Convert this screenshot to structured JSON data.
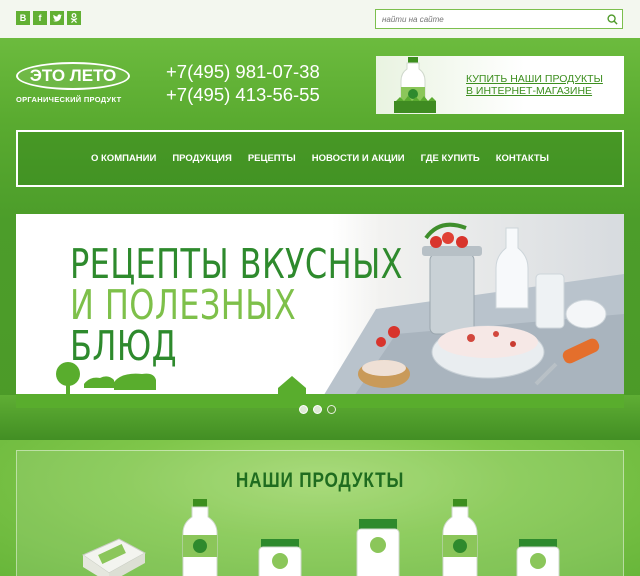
{
  "social": {
    "items": [
      {
        "name": "vk",
        "glyph": "В"
      },
      {
        "name": "facebook",
        "glyph": "f"
      },
      {
        "name": "twitter",
        "glyph": "t"
      },
      {
        "name": "odnoklassniki",
        "glyph": "ок"
      }
    ]
  },
  "search": {
    "placeholder": "найти на сайте"
  },
  "logo": {
    "text": "ЭТО ЛЕТО",
    "subtitle": "ОРГАНИЧЕСКИЙ ПРОДУКТ"
  },
  "phones": [
    "+7(495) 981-07-38",
    "+7(495) 413-56-55"
  ],
  "buy": {
    "line1": "КУПИТЬ НАШИ ПРОДУКТЫ",
    "line2": "В ИНТЕРНЕТ-МАГАЗИНЕ"
  },
  "nav": {
    "items": [
      "О КОМПАНИИ",
      "ПРОДУКЦИЯ",
      "РЕЦЕПТЫ",
      "НОВОСТИ И АКЦИИ",
      "ГДЕ КУПИТЬ",
      "КОНТАКТЫ"
    ]
  },
  "banner": {
    "line1": "РЕЦЕПТЫ ВКУСНЫХ",
    "line2": "И ПОЛЕЗНЫХ",
    "line3": "БЛЮД"
  },
  "slider": {
    "count": 3,
    "active": 3
  },
  "products": {
    "title": "НАШИ ПРОДУКТЫ"
  },
  "colors": {
    "brand_green": "#5aab30",
    "dark_green": "#2e8a2d",
    "light_green": "#7ec04a",
    "link_green": "#3c8e1e"
  }
}
